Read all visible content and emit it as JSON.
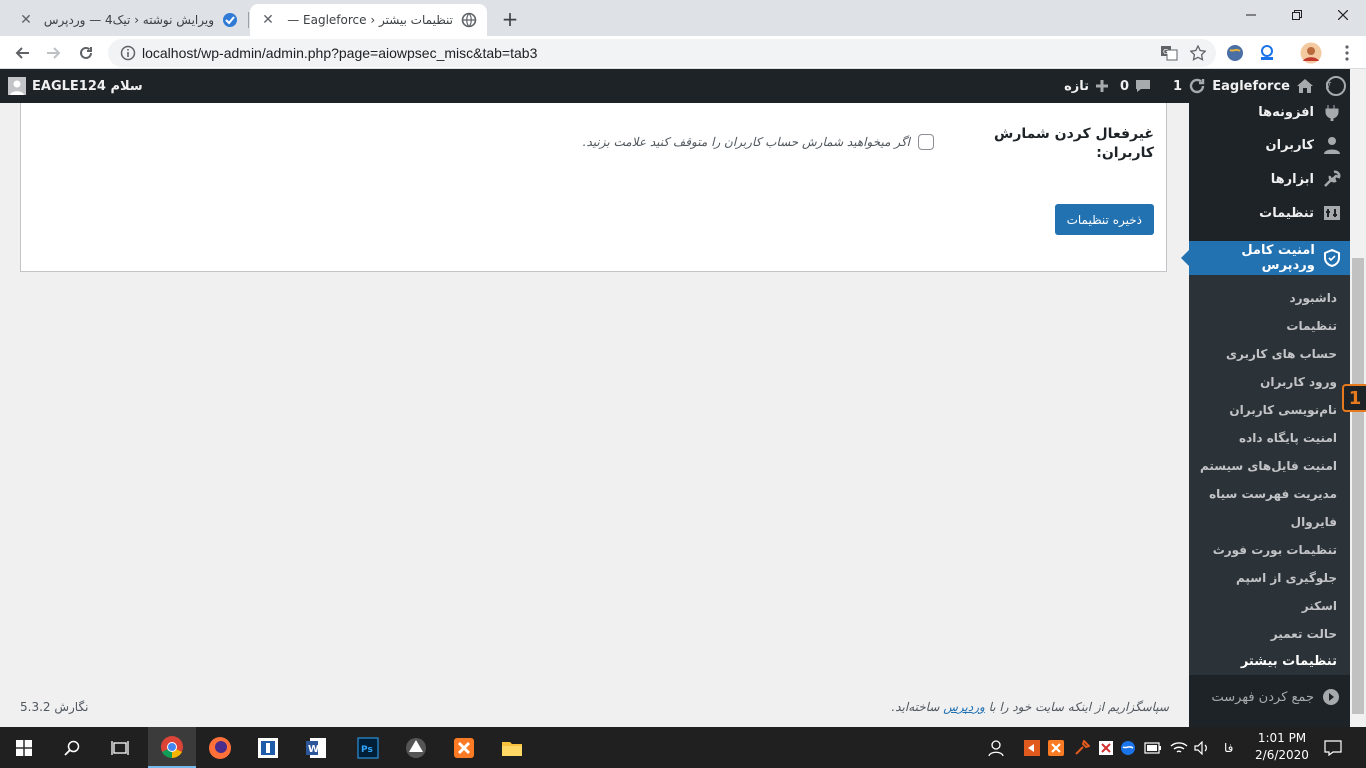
{
  "browser": {
    "tabs": [
      {
        "title": "ویرایش نوشته ‹ تیک4 — وردپرس",
        "active": false
      },
      {
        "title": "تنظیمات بیشتر ‹ Eagleforce — ورد",
        "active": true
      }
    ],
    "url": "localhost/wp-admin/admin.php?page=aiowpsec_misc&tab=tab3",
    "new_tab": "+"
  },
  "adminbar": {
    "site_name": "Eagleforce",
    "updates_count": "1",
    "comments_count": "0",
    "new_label": "تازه",
    "greeting": "سلام EAGLE124"
  },
  "sidebar": {
    "items": [
      {
        "label": "افزونه‌ها",
        "icon": "plugin-icon"
      },
      {
        "label": "کاربران",
        "icon": "users-icon"
      },
      {
        "label": "ابزارها",
        "icon": "tools-icon"
      },
      {
        "label": "تنظیمات",
        "icon": "settings-icon"
      }
    ],
    "current": {
      "label": "امنیت کامل وردپرس",
      "icon": "shield-icon"
    },
    "submenu": [
      "داشبورد",
      "تنظیمات",
      "حساب های کاربری",
      "ورود کاربران",
      "نام‌نویسی کاربران",
      "امنیت پایگاه داده",
      "امنیت فایل‌های سیستم",
      "مدیریت فهرست سیاه",
      "فایروال",
      "تنظیمات بورت فورث",
      "جلوگیری از اسپم",
      "اسکنر",
      "حالت تعمیر",
      "تنظیمات بیشتر"
    ],
    "collapse_label": "جمع کردن فهرست"
  },
  "settings": {
    "label": "غیرفعال کردن شمارش کاربران:",
    "description": "اگر میخواهید شمارش حساب کاربران را متوقف کنید علامت بزنید.",
    "checked": false,
    "save_button": "ذخیره تنظیمات"
  },
  "footer": {
    "thanks_prefix": "سپاسگزاریم از اینکه سایت خود را با",
    "thanks_link": "وردپرس",
    "thanks_suffix": "ساخته‌اید.",
    "version": "نگارش 5.3.2"
  },
  "badge": "1",
  "taskbar": {
    "apps": [
      "start-icon",
      "search-icon",
      "task-view-icon",
      "chrome-icon",
      "firefox-icon",
      "app-icon",
      "word-icon",
      "photoshop-icon",
      "inkscape-icon",
      "xampp-icon",
      "explorer-icon"
    ],
    "language": "فا",
    "time": "1:01 PM",
    "date": "2/6/2020"
  },
  "colors": {
    "wp_dark": "#1d2327",
    "wp_blue": "#2271b1",
    "content_bg": "#f0f0f1"
  }
}
